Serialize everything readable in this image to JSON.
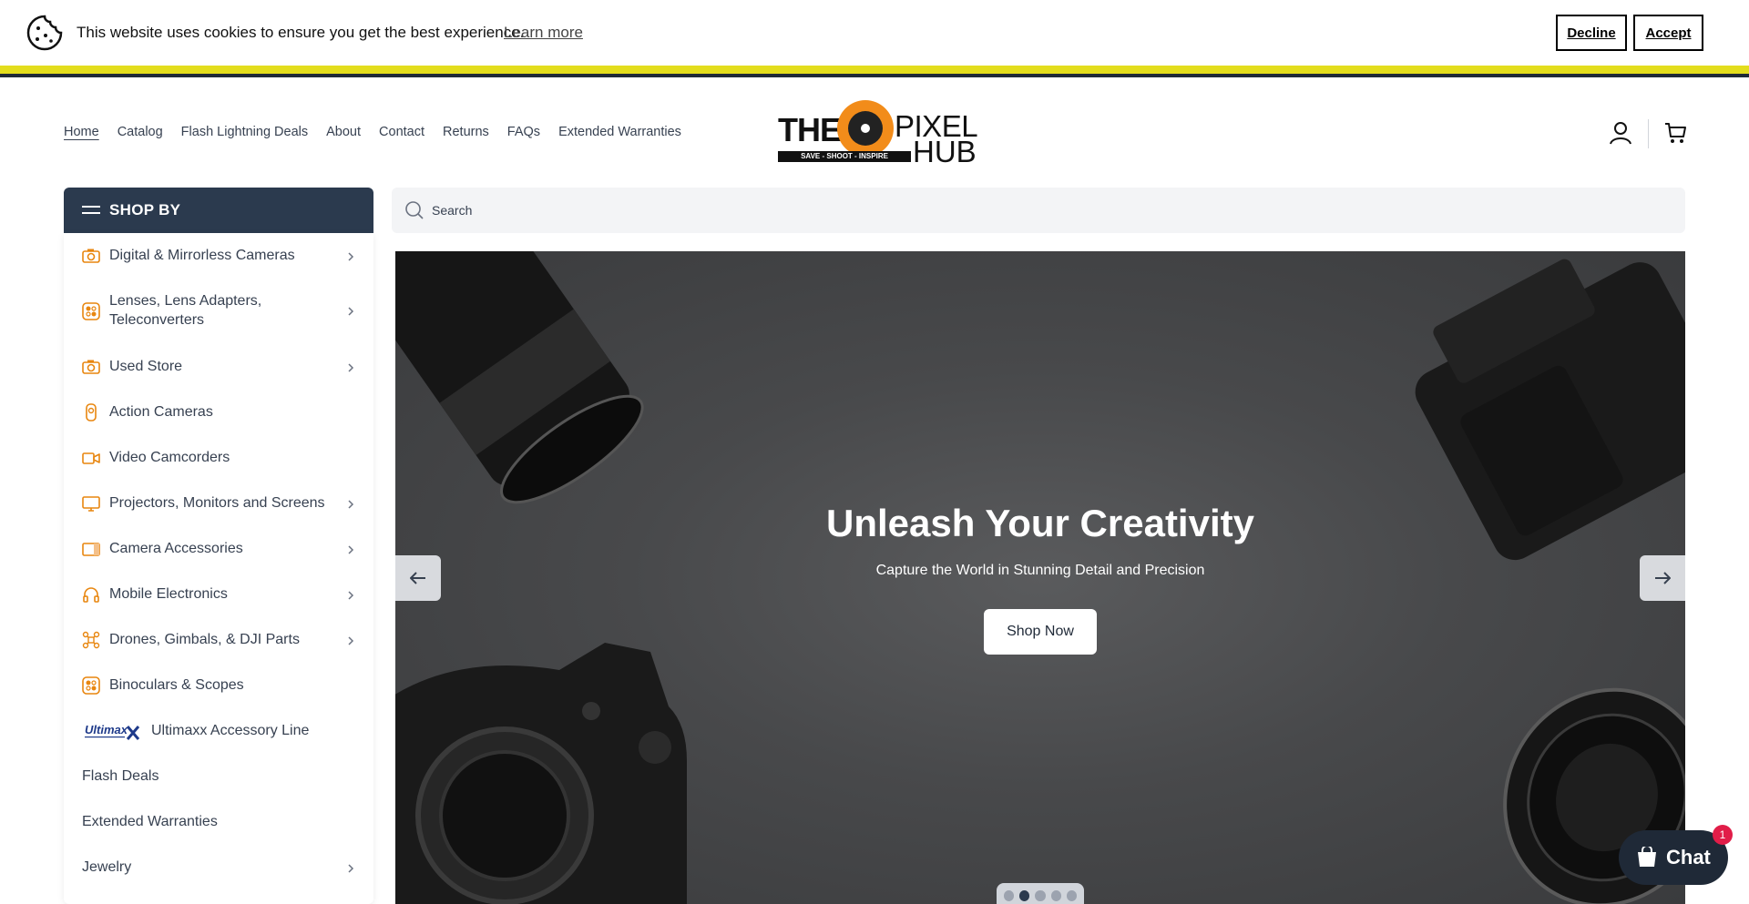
{
  "cookie": {
    "message": "This website uses cookies to ensure you get the best experience.",
    "learn_more": "Learn more",
    "decline": "Decline",
    "accept": "Accept",
    "stripe_colors": [
      "#e3dd1d",
      "#1f2937"
    ]
  },
  "header": {
    "nav": [
      "Home",
      "Catalog",
      "Flash Lightning Deals",
      "About",
      "Contact",
      "Returns",
      "FAQs",
      "Extended Warranties"
    ],
    "active_nav": "Home",
    "logo": {
      "the": "THE",
      "pixel": "PIXEL",
      "hub": "HUB",
      "tagline": "SAVE - SHOOT - INSPIRE"
    }
  },
  "sidebar": {
    "title": "SHOP BY",
    "items": [
      {
        "label": "Digital & Mirrorless Cameras",
        "icon": "camera-icon",
        "has_submenu": true
      },
      {
        "label": "Lenses, Lens Adapters, Teleconverters",
        "icon": "lens-icon",
        "has_submenu": true
      },
      {
        "label": "Used Store",
        "icon": "camera-icon",
        "has_submenu": true
      },
      {
        "label": "Action Cameras",
        "icon": "action-camera-icon",
        "has_submenu": false
      },
      {
        "label": "Video Camcorders",
        "icon": "video-icon",
        "has_submenu": false
      },
      {
        "label": "Projectors, Monitors and Screens",
        "icon": "monitor-icon",
        "has_submenu": true
      },
      {
        "label": "Camera Accessories",
        "icon": "accessory-icon",
        "has_submenu": true
      },
      {
        "label": "Mobile Electronics",
        "icon": "headphones-icon",
        "has_submenu": true
      },
      {
        "label": "Drones, Gimbals, & DJI Parts",
        "icon": "drone-icon",
        "has_submenu": true
      },
      {
        "label": "Binoculars & Scopes",
        "icon": "binoculars-icon",
        "has_submenu": false
      },
      {
        "label": "Ultimaxx Accessory Line",
        "icon": "ultimaxx-logo",
        "has_submenu": false
      },
      {
        "label": "Flash Deals",
        "icon": "",
        "has_submenu": false
      },
      {
        "label": "Extended Warranties",
        "icon": "",
        "has_submenu": false
      },
      {
        "label": "Jewelry",
        "icon": "",
        "has_submenu": true
      }
    ],
    "ultimaxx_logo_text": "Ultimax",
    "accent": "#e8860f",
    "header_color": "#2b3a4e"
  },
  "search": {
    "placeholder": "Search"
  },
  "hero": {
    "title": "Unleash Your Creativity",
    "subtitle": "Capture the World in Stunning Detail and Precision",
    "cta": "Shop Now",
    "slide_count": 5,
    "active_slide": 2
  },
  "chat": {
    "label": "Chat",
    "badge": "1"
  }
}
